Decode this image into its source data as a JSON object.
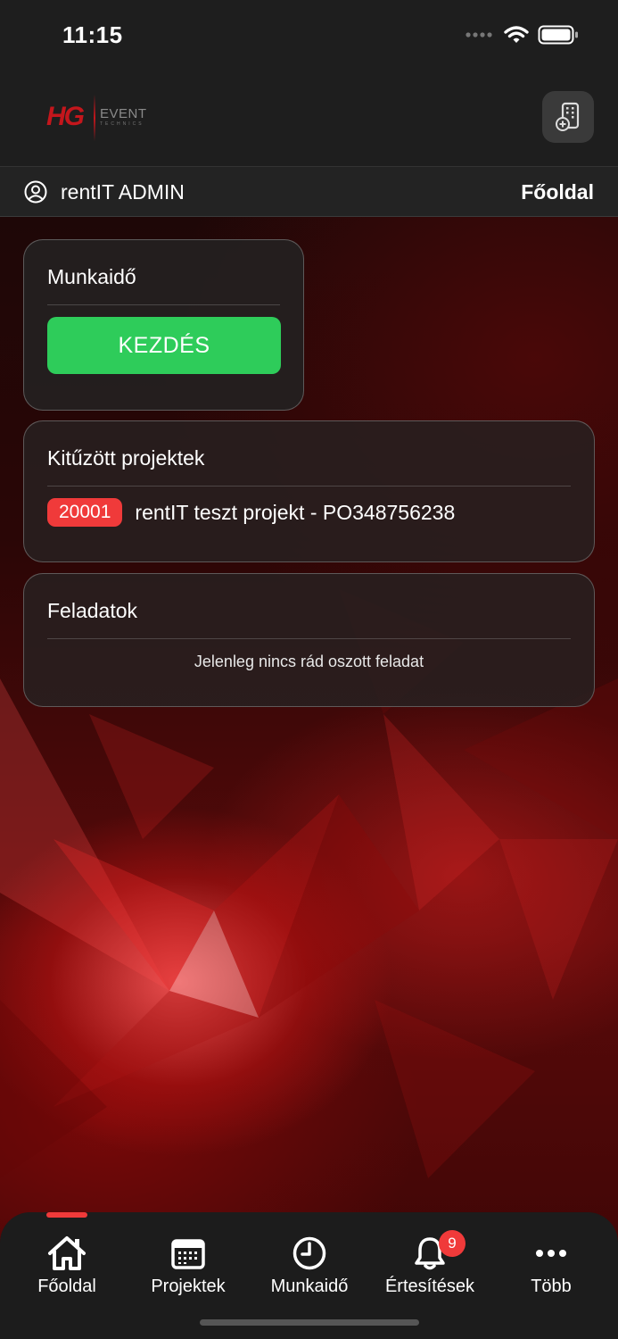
{
  "status_bar": {
    "time": "11:15"
  },
  "header": {
    "logo": {
      "brand": "HG",
      "sub": "EVENT",
      "tagline": "TECHNICS"
    }
  },
  "user_bar": {
    "user_name": "rentIT ADMIN",
    "page_title": "Főoldal"
  },
  "work_time": {
    "title": "Munkaidő",
    "start_label": "KEZDÉS"
  },
  "pinned_projects": {
    "title": "Kitűzött projektek",
    "items": [
      {
        "id": "20001",
        "name": "rentIT teszt projekt - PO348756238"
      }
    ]
  },
  "tasks": {
    "title": "Feladatok",
    "empty_text": "Jelenleg nincs rád oszott feladat"
  },
  "tab_bar": {
    "tabs": [
      {
        "label": "Főoldal",
        "icon": "home-icon"
      },
      {
        "label": "Projektek",
        "icon": "calendar-icon"
      },
      {
        "label": "Munkaidő",
        "icon": "clock-icon"
      },
      {
        "label": "Értesítések",
        "icon": "bell-icon",
        "badge": "9"
      },
      {
        "label": "Több",
        "icon": "more-icon"
      }
    ],
    "active_tab": "Főoldal"
  },
  "colors": {
    "accent": "#f03a3a",
    "start_button": "#2ecc5a",
    "brand_red": "#c4161c"
  }
}
